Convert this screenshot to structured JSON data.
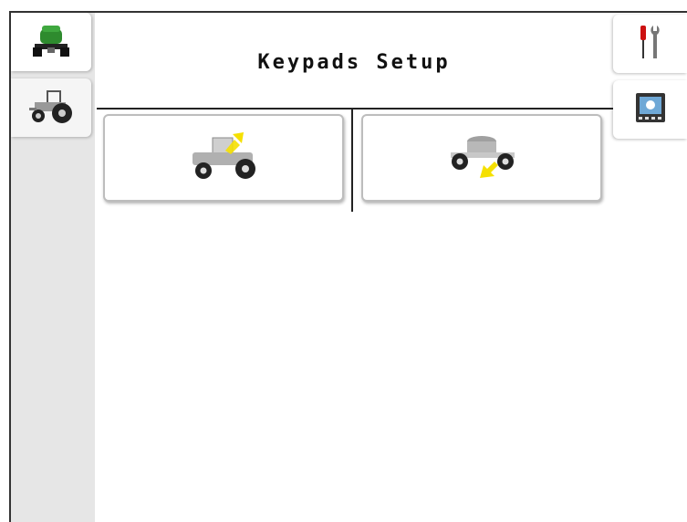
{
  "header": {
    "title": "Keypads Setup"
  },
  "sidebar": {
    "tabs": [
      {
        "icon": "implement-vehicle-icon"
      },
      {
        "icon": "tractor-icon"
      }
    ]
  },
  "right_tabs": [
    {
      "icon": "tools-icon"
    },
    {
      "icon": "display-screen-icon"
    }
  ],
  "main": {
    "buttons": [
      {
        "icon": "tractor-keypad-icon"
      },
      {
        "icon": "implement-keypad-icon"
      }
    ]
  },
  "colors": {
    "accent": "#f5e000",
    "brand_green": "#2e8b2e"
  }
}
